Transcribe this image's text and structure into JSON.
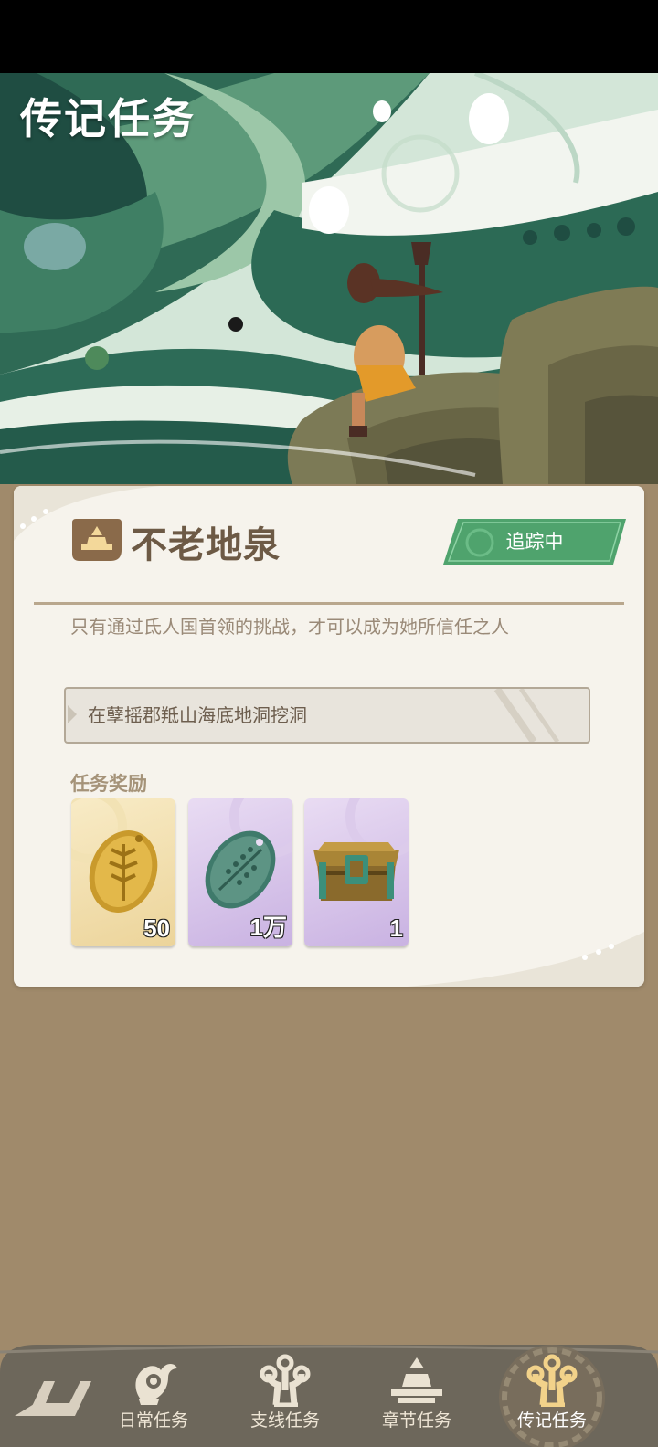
{
  "page": {
    "title": "传记任务"
  },
  "quest": {
    "name": "不老地泉",
    "status": "追踪中",
    "description": "只有通过氐人国首领的挑战，才可以成为她所信任之人",
    "objective": "在孽摇郡羝山海底地洞挖洞"
  },
  "rewards": {
    "title": "任务奖励",
    "items": [
      {
        "icon": "gold-shell-coin-icon",
        "qty": "50"
      },
      {
        "icon": "jade-shell-coin-icon",
        "qty": "1万"
      },
      {
        "icon": "treasure-chest-icon",
        "qty": "1"
      }
    ]
  },
  "nav": {
    "items": [
      {
        "label": "日常任务",
        "icon": "bird-emblem-icon"
      },
      {
        "label": "支线任务",
        "icon": "branch-emblem-icon"
      },
      {
        "label": "章节任务",
        "icon": "altar-emblem-icon"
      },
      {
        "label": "传记任务",
        "icon": "branch-emblem-icon",
        "active": true
      }
    ]
  },
  "colors": {
    "accent_green": "#4fa36d",
    "page_bg": "#a08a6b",
    "card_bg": "#f6f3ec",
    "nav_bg": "#6d675b"
  }
}
